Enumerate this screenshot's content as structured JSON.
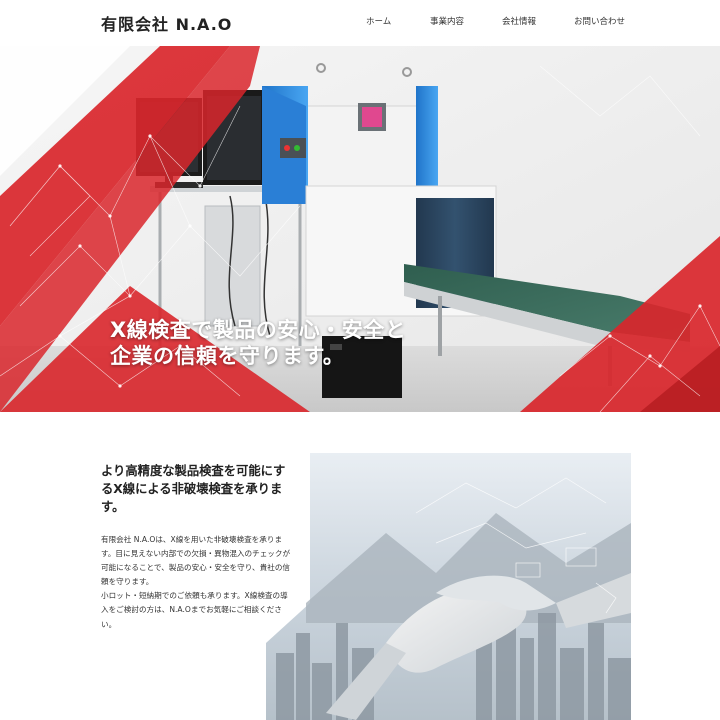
{
  "header": {
    "logo": "有限会社 N.A.O",
    "nav": [
      "ホーム",
      "事業内容",
      "会社情報",
      "お問い合わせ"
    ]
  },
  "hero": {
    "line1": "X線検査で製品の安心・安全と",
    "line2": "企業の信頼を守ります。"
  },
  "intro": {
    "heading": "より高精度な製品検査を可能にするX線による非破壊検査を承ります。",
    "paragraph1": "有限会社 N.A.Oは、X線を用いた非破壊検査を承ります。目に見えない内部での欠損・異物混入のチェックが可能になることで、製品の安心・安全を守り、貴社の信頼を守ります。",
    "paragraph2": "小ロット・短納期でのご依頼も承ります。X線検査の導入をご検討の方は、N.A.Oまでお気軽にご相談ください。"
  },
  "colors": {
    "accent_red": "#d9262b",
    "machine_blue": "#2d8de0",
    "belt_green": "#3d6d5c"
  }
}
